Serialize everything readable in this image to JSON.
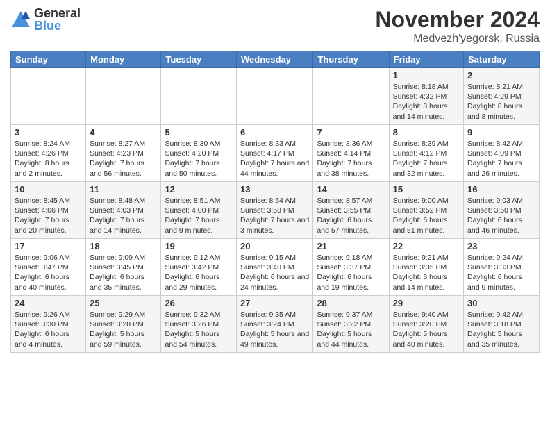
{
  "logo": {
    "general": "General",
    "blue": "Blue"
  },
  "title": {
    "month": "November 2024",
    "location": "Medvezh'yegorsk, Russia"
  },
  "weekdays": [
    "Sunday",
    "Monday",
    "Tuesday",
    "Wednesday",
    "Thursday",
    "Friday",
    "Saturday"
  ],
  "weeks": [
    [
      {
        "day": "",
        "info": ""
      },
      {
        "day": "",
        "info": ""
      },
      {
        "day": "",
        "info": ""
      },
      {
        "day": "",
        "info": ""
      },
      {
        "day": "",
        "info": ""
      },
      {
        "day": "1",
        "info": "Sunrise: 8:18 AM\nSunset: 4:32 PM\nDaylight: 8 hours\nand 14 minutes."
      },
      {
        "day": "2",
        "info": "Sunrise: 8:21 AM\nSunset: 4:29 PM\nDaylight: 8 hours\nand 8 minutes."
      }
    ],
    [
      {
        "day": "3",
        "info": "Sunrise: 8:24 AM\nSunset: 4:26 PM\nDaylight: 8 hours\nand 2 minutes."
      },
      {
        "day": "4",
        "info": "Sunrise: 8:27 AM\nSunset: 4:23 PM\nDaylight: 7 hours\nand 56 minutes."
      },
      {
        "day": "5",
        "info": "Sunrise: 8:30 AM\nSunset: 4:20 PM\nDaylight: 7 hours\nand 50 minutes."
      },
      {
        "day": "6",
        "info": "Sunrise: 8:33 AM\nSunset: 4:17 PM\nDaylight: 7 hours\nand 44 minutes."
      },
      {
        "day": "7",
        "info": "Sunrise: 8:36 AM\nSunset: 4:14 PM\nDaylight: 7 hours\nand 38 minutes."
      },
      {
        "day": "8",
        "info": "Sunrise: 8:39 AM\nSunset: 4:12 PM\nDaylight: 7 hours\nand 32 minutes."
      },
      {
        "day": "9",
        "info": "Sunrise: 8:42 AM\nSunset: 4:09 PM\nDaylight: 7 hours\nand 26 minutes."
      }
    ],
    [
      {
        "day": "10",
        "info": "Sunrise: 8:45 AM\nSunset: 4:06 PM\nDaylight: 7 hours\nand 20 minutes."
      },
      {
        "day": "11",
        "info": "Sunrise: 8:48 AM\nSunset: 4:03 PM\nDaylight: 7 hours\nand 14 minutes."
      },
      {
        "day": "12",
        "info": "Sunrise: 8:51 AM\nSunset: 4:00 PM\nDaylight: 7 hours\nand 9 minutes."
      },
      {
        "day": "13",
        "info": "Sunrise: 8:54 AM\nSunset: 3:58 PM\nDaylight: 7 hours\nand 3 minutes."
      },
      {
        "day": "14",
        "info": "Sunrise: 8:57 AM\nSunset: 3:55 PM\nDaylight: 6 hours\nand 57 minutes."
      },
      {
        "day": "15",
        "info": "Sunrise: 9:00 AM\nSunset: 3:52 PM\nDaylight: 6 hours\nand 51 minutes."
      },
      {
        "day": "16",
        "info": "Sunrise: 9:03 AM\nSunset: 3:50 PM\nDaylight: 6 hours\nand 46 minutes."
      }
    ],
    [
      {
        "day": "17",
        "info": "Sunrise: 9:06 AM\nSunset: 3:47 PM\nDaylight: 6 hours\nand 40 minutes."
      },
      {
        "day": "18",
        "info": "Sunrise: 9:09 AM\nSunset: 3:45 PM\nDaylight: 6 hours\nand 35 minutes."
      },
      {
        "day": "19",
        "info": "Sunrise: 9:12 AM\nSunset: 3:42 PM\nDaylight: 6 hours\nand 29 minutes."
      },
      {
        "day": "20",
        "info": "Sunrise: 9:15 AM\nSunset: 3:40 PM\nDaylight: 6 hours\nand 24 minutes."
      },
      {
        "day": "21",
        "info": "Sunrise: 9:18 AM\nSunset: 3:37 PM\nDaylight: 6 hours\nand 19 minutes."
      },
      {
        "day": "22",
        "info": "Sunrise: 9:21 AM\nSunset: 3:35 PM\nDaylight: 6 hours\nand 14 minutes."
      },
      {
        "day": "23",
        "info": "Sunrise: 9:24 AM\nSunset: 3:33 PM\nDaylight: 6 hours\nand 9 minutes."
      }
    ],
    [
      {
        "day": "24",
        "info": "Sunrise: 9:26 AM\nSunset: 3:30 PM\nDaylight: 6 hours\nand 4 minutes."
      },
      {
        "day": "25",
        "info": "Sunrise: 9:29 AM\nSunset: 3:28 PM\nDaylight: 5 hours\nand 59 minutes."
      },
      {
        "day": "26",
        "info": "Sunrise: 9:32 AM\nSunset: 3:26 PM\nDaylight: 5 hours\nand 54 minutes."
      },
      {
        "day": "27",
        "info": "Sunrise: 9:35 AM\nSunset: 3:24 PM\nDaylight: 5 hours\nand 49 minutes."
      },
      {
        "day": "28",
        "info": "Sunrise: 9:37 AM\nSunset: 3:22 PM\nDaylight: 5 hours\nand 44 minutes."
      },
      {
        "day": "29",
        "info": "Sunrise: 9:40 AM\nSunset: 3:20 PM\nDaylight: 5 hours\nand 40 minutes."
      },
      {
        "day": "30",
        "info": "Sunrise: 9:42 AM\nSunset: 3:18 PM\nDaylight: 5 hours\nand 35 minutes."
      }
    ]
  ]
}
